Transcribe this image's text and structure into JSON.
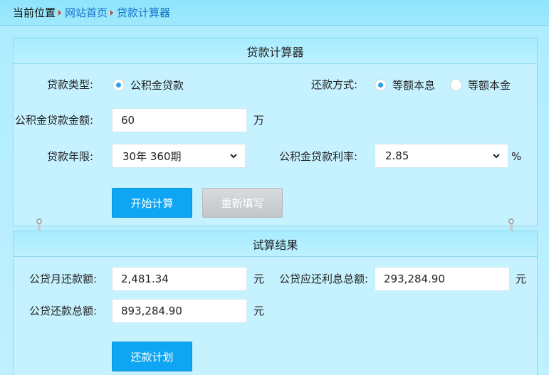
{
  "breadcrumb": {
    "lead": "当前位置",
    "items": [
      "网站首页",
      "贷款计算器"
    ]
  },
  "calculator": {
    "title": "贷款计算器",
    "loan_type_label": "贷款类型:",
    "loan_type_option": "公积金贷款",
    "repay_method_label": "还款方式:",
    "repay_options": [
      {
        "label": "等额本息",
        "selected": true
      },
      {
        "label": "等额本金",
        "selected": false
      }
    ],
    "amount_label": "公积金贷款金额:",
    "amount_value": "60",
    "amount_unit": "万",
    "term_label": "贷款年限:",
    "term_value": "30年 360期",
    "rate_label": "公积金贷款利率:",
    "rate_value": "2.85",
    "rate_unit": "%",
    "calc_button": "开始计算",
    "reset_button": "重新填写"
  },
  "result": {
    "title": "试算结果",
    "monthly_label": "公贷月还款额:",
    "monthly_value": "2,481.34",
    "monthly_unit": "元",
    "interest_label": "公贷应还利息总额:",
    "interest_value": "293,284.90",
    "interest_unit": "元",
    "total_label": "公贷还款总额:",
    "total_value": "893,284.90",
    "total_unit": "元",
    "plan_button": "还款计划"
  },
  "colors": {
    "accent": "#0ea5f2",
    "link": "#1673c9",
    "background": "#bff0ff"
  }
}
